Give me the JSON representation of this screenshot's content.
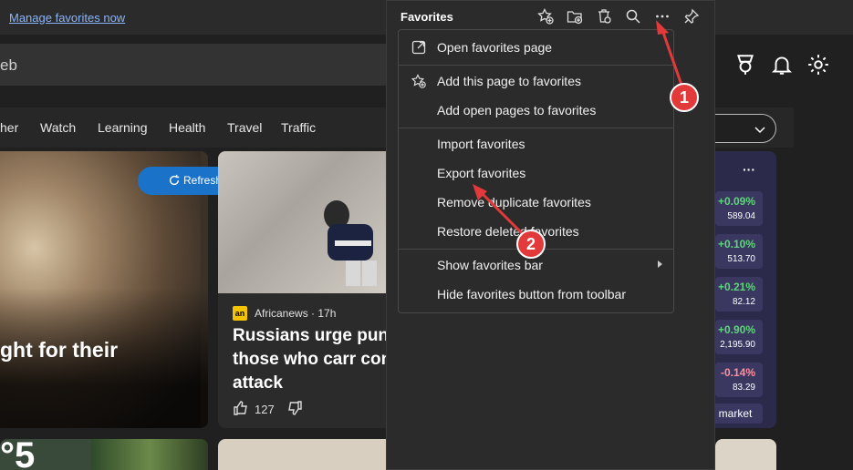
{
  "infobar": {
    "link": "Manage favorites now"
  },
  "search": {
    "query": "eb"
  },
  "nav": {
    "items": [
      "her",
      "Watch",
      "Learning",
      "Health",
      "Travel",
      "Traffic"
    ]
  },
  "hero": {
    "headline": "ght for their"
  },
  "refresh": {
    "label": "Refresh stories"
  },
  "card": {
    "source_logo": "an",
    "source": "Africanews · 17h",
    "title": "Russians urge puni for those who carr concert attack",
    "likes": "127"
  },
  "bottom_tile": {
    "text": "°5"
  },
  "market": {
    "dots": "···",
    "quotes": [
      {
        "pct": "+0.09%",
        "val": "589.04",
        "dir": "up"
      },
      {
        "pct": "+0.10%",
        "val": "513.70",
        "dir": "up"
      },
      {
        "pct": "+0.21%",
        "val": "82.12",
        "dir": "up"
      },
      {
        "pct": "+0.90%",
        "val": "2,195.90",
        "dir": "up"
      },
      {
        "pct": "-0.14%",
        "val": "83.29",
        "dir": "down"
      }
    ],
    "button": "market"
  },
  "favorites": {
    "title": "Favorites",
    "menu": {
      "open_page": "Open favorites page",
      "add_page": "Add this page to favorites",
      "add_open": "Add open pages to favorites",
      "import": "Import favorites",
      "export": "Export favorites",
      "remove_dup": "Remove duplicate favorites",
      "restore": "Restore deleted favorites",
      "show_bar": "Show favorites bar",
      "hide_button": "Hide favorites button from toolbar"
    }
  },
  "annotations": {
    "one": "1",
    "two": "2"
  },
  "colors": {
    "accent": "#1a73c9",
    "badge": "#e23a3a",
    "up": "#5ed57a",
    "down": "#ff8e9e"
  }
}
